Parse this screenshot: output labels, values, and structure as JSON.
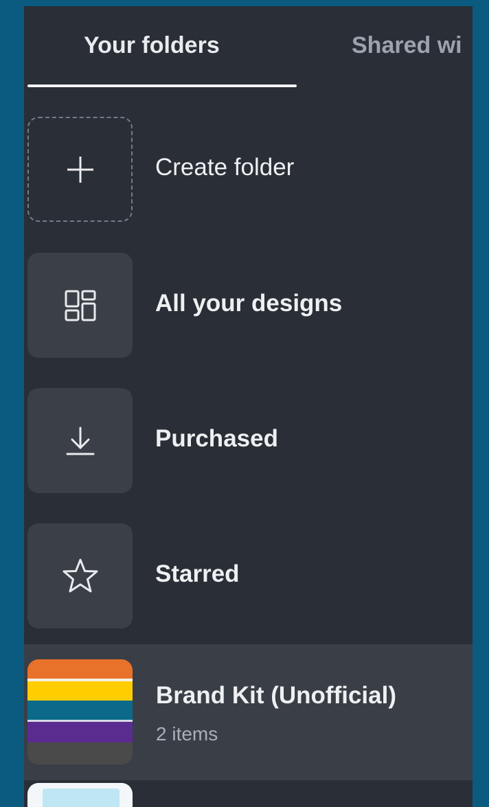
{
  "tabs": [
    {
      "label": "Your folders",
      "active": true
    },
    {
      "label": "Shared wi",
      "active": false
    }
  ],
  "items": [
    {
      "label": "Create folder",
      "icon": "plus-icon"
    },
    {
      "label": "All your designs",
      "icon": "grid-icon"
    },
    {
      "label": "Purchased",
      "icon": "download-icon"
    },
    {
      "label": "Starred",
      "icon": "star-icon"
    }
  ],
  "brand_kit": {
    "title": "Brand Kit (Unofficial)",
    "count": "2 items",
    "colors": [
      "#e8722a",
      "#ffcd00",
      "#0b6a8a",
      "#5b2c8f",
      "#4a4a4a"
    ]
  },
  "theme": {
    "background": "#0b5a7f",
    "panel": "#2a2e36",
    "tile": "#3b3f47",
    "highlight_row": "#3a3e46"
  }
}
